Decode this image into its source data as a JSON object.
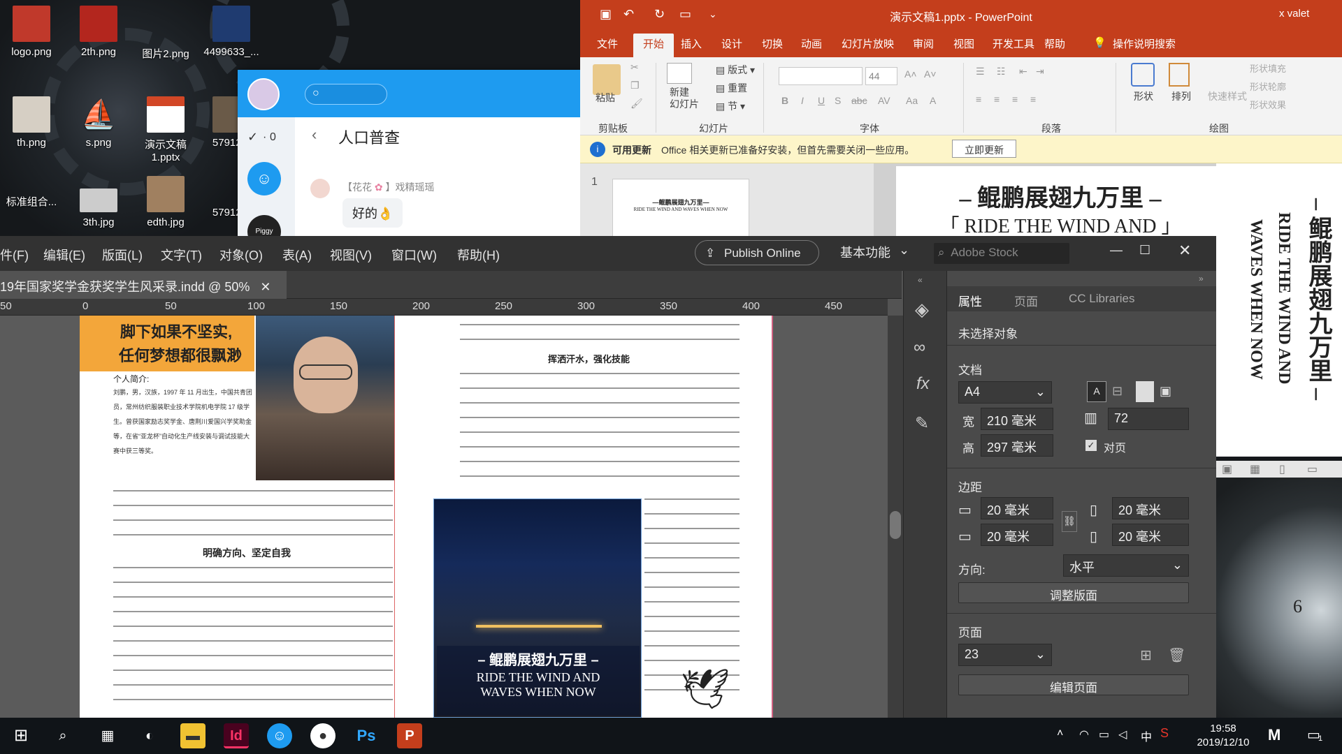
{
  "desktop": {
    "icons": [
      {
        "label": "logo.png",
        "color": "#c0392b"
      },
      {
        "label": "2th.png",
        "color": "#b3261e"
      },
      {
        "label": "图片2.png",
        "color": "#1f3b70"
      },
      {
        "label": "4499633_...",
        "color": "#2b4d7a"
      },
      {
        "label": "th.png",
        "color": "#8a6a46"
      },
      {
        "label": "s.png",
        "color": "#3b5b80"
      },
      {
        "label": "演示文稿1.pptx",
        "color": "#d24726"
      },
      {
        "label": "57912...",
        "color": "#6a5a48"
      },
      {
        "label": "标准组合...",
        "color": "#555555"
      },
      {
        "label": "3th.jpg",
        "color": "#cccccc"
      },
      {
        "label": "edth.jpg",
        "color": "#a08060"
      },
      {
        "label": "57912...",
        "color": "#6a5a48"
      }
    ]
  },
  "qq": {
    "unread_count": "0",
    "chat_title": "人口普查",
    "sender_prefix": "【花花",
    "sender_suffix": "】戏精瑶瑶",
    "message": "好的👌",
    "avatar_label": "Piggy"
  },
  "ppt": {
    "title": "演示文稿1.pptx - PowerPoint",
    "user": "x valet",
    "tabs": [
      "文件",
      "开始",
      "插入",
      "设计",
      "切换",
      "动画",
      "幻灯片放映",
      "审阅",
      "视图",
      "开发工具",
      "帮助"
    ],
    "tell_me": "操作说明搜索",
    "clipboard": {
      "paste": "粘贴",
      "label": "剪贴板"
    },
    "slides": {
      "new_slide": "新建\n幻灯片",
      "layout": "版式",
      "reset": "重置",
      "section": "节",
      "label": "幻灯片"
    },
    "font": {
      "size": "44",
      "label": "字体"
    },
    "paragraph_label": "段落",
    "drawing": {
      "shapes": "形状",
      "arrange": "排列",
      "quick_styles": "快速样式",
      "fill": "形状填充",
      "outline": "形状轮廓",
      "effects": "形状效果",
      "label": "绘图"
    },
    "update_bar": {
      "title": "可用更新",
      "message": "Office 相关更新已准备好安装，但首先需要关闭一些应用。",
      "button": "立即更新"
    },
    "slide_number": "1",
    "slide_title": "– 鲲鹏展翅九万里 –",
    "slide_subtitle": "「 RIDE THE WIND AND 」",
    "thumb_title": "—鲲鹏展翅九万里—",
    "thumb_sub": "RIDE THE WIND AND WAVES WHEN NOW"
  },
  "indesign": {
    "menus": [
      "件(F)",
      "编辑(E)",
      "版面(L)",
      "文字(T)",
      "对象(O)",
      "表(A)",
      "视图(V)",
      "窗口(W)",
      "帮助(H)"
    ],
    "publish_online": "Publish Online",
    "workspace": "基本功能",
    "stock_search_placeholder": "Adobe Stock",
    "doc_tab": "19年国家奖学金获奖学生风采录.indd @ 50%",
    "ruler_labels": [
      "50",
      "0",
      "50",
      "100",
      "150",
      "200",
      "250",
      "300",
      "350",
      "400",
      "450"
    ],
    "panel_tabs": [
      "属性",
      "页面",
      "CC Libraries"
    ],
    "no_selection": "未选择对象",
    "document_heading": "文档",
    "page_size": "A4",
    "width_label": "宽",
    "width_value": "210 毫米",
    "height_label": "高",
    "height_value": "297 毫米",
    "pages_count": "72",
    "facing_pages": "对页",
    "margins_heading": "边距",
    "margin_top": "20 毫米",
    "margin_bottom": "20 毫米",
    "margin_left": "20 毫米",
    "margin_right": "20 毫米",
    "orientation_label": "方向:",
    "orientation_value": "水平",
    "adjust_layout": "调整版面",
    "pages_heading": "页面",
    "current_page": "23",
    "edit_page": "编辑页面",
    "left_page": {
      "headline_1": "脚下如果不坚实,",
      "headline_2": "任何梦想都很飘渺",
      "intro_label": "个人简介:",
      "intro_text": "刘鹏，男，汉族，1997 年 11 月出生，中国共青团员，常州纺织服装职业技术学院机电学院 17 级学生。曾获国家励志奖学金、唐荆川爱国兴学奖助金等，在省“亚龙杯”自动化生产线安装与调试技能大赛中获三等奖。",
      "section_heading": "明确方向、坚定自我"
    },
    "right_page": {
      "section_heading": "挥洒汗水，强化技能",
      "photo_title": "– 鲲鹏展翅九万里 –",
      "photo_sub_1": "RIDE THE WIND AND",
      "photo_sub_2": "WAVES WHEN NOW"
    }
  },
  "right_slide": {
    "vertical_title": "– 鲲鹏展翅九万里 –",
    "vertical_en_1": "RIDE THE WIND AND",
    "vertical_en_2": "WAVES WHEN NOW"
  },
  "taskbar": {
    "apps": [
      "Id",
      "Ps",
      "P"
    ],
    "time": "19:58",
    "date": "2019/12/10",
    "ime": "中",
    "notification_count": "1"
  },
  "colors": {
    "ppt_red": "#c43e1c",
    "qq_blue": "#1e9bf0",
    "indesign_pink": "#ff3366",
    "ps_blue": "#31a8ff",
    "taskbar": "#101418"
  }
}
